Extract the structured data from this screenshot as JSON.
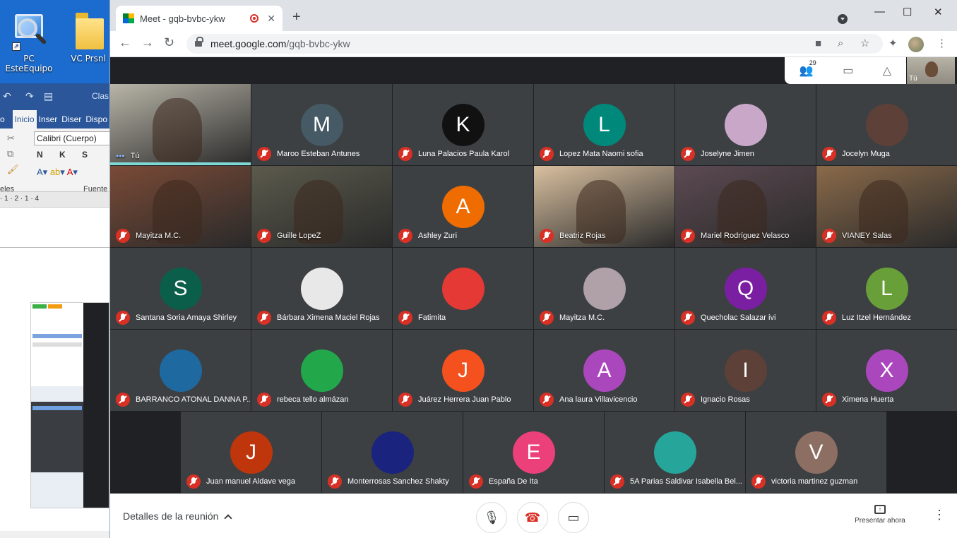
{
  "desktop": {
    "icons": [
      {
        "label": "PC EsteEquipo",
        "icon": "computer-icon"
      },
      {
        "label": "VC Prsnl",
        "icon": "folder-icon"
      }
    ]
  },
  "word": {
    "title_fragment": "Clas",
    "tabs": [
      "Inicio",
      "Inser",
      "Diser",
      "Dispo"
    ],
    "font_name": "Calibri (Cuerpo)",
    "format_buttons": "N K S",
    "group_label_left": "eles",
    "group_label_font": "Fuente",
    "ruler": "· 1 · 2 · 1 · 4"
  },
  "browser": {
    "tab_title": "Meet - gqb-bvbc-ykw",
    "new_tab": "+",
    "url_host": "meet.google.com",
    "url_path": "/gqb-bvbc-ykw",
    "window_controls": [
      "—",
      "☐",
      "✕"
    ]
  },
  "meet": {
    "people_count": "29",
    "self_label": "Tú",
    "tiles": [
      {
        "name": "Tú",
        "kind": "video",
        "bg": "#b9b5a8"
      },
      {
        "name": "Maroo Esteban Antunes",
        "kind": "avatar",
        "letter": "M",
        "color": "#455a64"
      },
      {
        "name": "Luna Palacios Paula Karol",
        "kind": "avatar",
        "letter": "K",
        "color": "#111111"
      },
      {
        "name": "Lopez Mata Naomi sofia",
        "kind": "avatar",
        "letter": "L",
        "color": "#00897b"
      },
      {
        "name": "Joselyne Jimen",
        "kind": "avatar",
        "letter": "",
        "color": "#c9a7c9"
      },
      {
        "name": "Jocelyn Muga",
        "kind": "avatar",
        "letter": "",
        "color": "#5d4037"
      },
      {
        "name": "Mayitza M.C.",
        "kind": "video",
        "bg": "#7a4a36"
      },
      {
        "name": "Guille LopeZ",
        "kind": "video",
        "bg": "#5b5a4c"
      },
      {
        "name": "Ashley Zuri",
        "kind": "avatar",
        "letter": "A",
        "color": "#ef6c00"
      },
      {
        "name": "Beatriz Rojas",
        "kind": "video",
        "bg": "#d9c0a0"
      },
      {
        "name": "Mariel Rodríguez Velasco",
        "kind": "video",
        "bg": "#5c4a52"
      },
      {
        "name": "VIANEY Salas",
        "kind": "video",
        "bg": "#8a6a4a"
      },
      {
        "name": "Santana Soria Amaya Shirley",
        "kind": "avatar",
        "letter": "S",
        "color": "#0b5e4a"
      },
      {
        "name": "Bárbara Ximena Maciel Rojas",
        "kind": "avatar",
        "letter": "",
        "color": "#e8e8e8"
      },
      {
        "name": "Fatimita",
        "kind": "avatar",
        "letter": "",
        "color": "#e53935"
      },
      {
        "name": "Mayitza M.C.",
        "kind": "avatar",
        "letter": "",
        "color": "#b0a0a8"
      },
      {
        "name": "Quecholac Salazar ivi",
        "kind": "avatar",
        "letter": "Q",
        "color": "#7b1fa2"
      },
      {
        "name": "Luz Itzel Hernández",
        "kind": "avatar",
        "letter": "L",
        "color": "#689f38"
      },
      {
        "name": "BARRANCO ATONAL DANNA P...",
        "kind": "avatar",
        "letter": "",
        "color": "#1e6aa0"
      },
      {
        "name": "rebeca tello almázan",
        "kind": "avatar",
        "letter": "",
        "color": "#22a84a"
      },
      {
        "name": "Juárez Herrera Juan Pablo",
        "kind": "avatar",
        "letter": "J",
        "color": "#f4511e"
      },
      {
        "name": "Ana laura Villavicencio",
        "kind": "avatar",
        "letter": "A",
        "color": "#ab47bc"
      },
      {
        "name": "Ignacio Rosas",
        "kind": "avatar",
        "letter": "I",
        "color": "#5d4037"
      },
      {
        "name": "Ximena Huerta",
        "kind": "avatar",
        "letter": "X",
        "color": "#ab47bc"
      },
      {
        "name": "Juan manuel Aldave vega",
        "kind": "avatar",
        "letter": "J",
        "color": "#bf360c"
      },
      {
        "name": "Monterrosas Sanchez Shakty",
        "kind": "avatar",
        "letter": "",
        "color": "#1a237e"
      },
      {
        "name": "España De Ita",
        "kind": "avatar",
        "letter": "E",
        "color": "#ec407a"
      },
      {
        "name": "5A Parias Saldivar Isabella Bel...",
        "kind": "avatar",
        "letter": "",
        "color": "#26a69a"
      },
      {
        "name": "victoria martinez guzman",
        "kind": "avatar",
        "letter": "V",
        "color": "#8d6e63"
      }
    ],
    "bottom": {
      "details_label": "Detalles de la reunión",
      "present_label": "Presentar ahora"
    }
  }
}
